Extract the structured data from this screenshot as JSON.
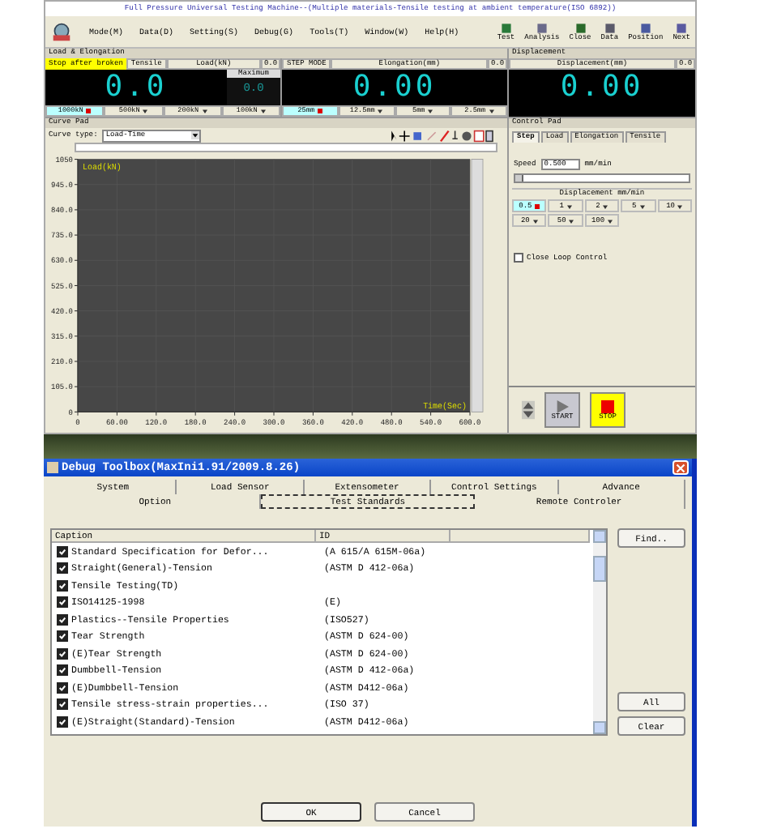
{
  "main_window": {
    "title": "Full Pressure Universal Testing Machine--(Multiple materials-Tensile testing at ambient temperature(ISO 6892))",
    "menus": [
      "Mode(M)",
      "Data(D)",
      "Setting(S)",
      "Debug(G)",
      "Tools(T)",
      "Window(W)",
      "Help(H)"
    ],
    "toolbar": [
      "Test",
      "Analysis",
      "Close",
      "Data",
      "Position",
      "Next"
    ]
  },
  "load_panel": {
    "title": "Load & Elongation",
    "mode_badge": "Stop after broken",
    "mode": "Tensile",
    "load": {
      "label": "Load(kN)",
      "reset": "0.0",
      "value": "0.0",
      "max_label": "Maximum",
      "max_value": "0.0",
      "ranges": [
        {
          "label": "1000kN",
          "selected": true
        },
        {
          "label": "500kN",
          "selected": false
        },
        {
          "label": "200kN",
          "selected": false
        },
        {
          "label": "100kN",
          "selected": false
        }
      ]
    },
    "elongation": {
      "mode": "STEP MODE",
      "label": "Elongation(mm)",
      "reset": "0.0",
      "value": "0.00",
      "ranges": [
        {
          "label": "25mm",
          "selected": true
        },
        {
          "label": "12.5mm",
          "selected": false
        },
        {
          "label": "5mm",
          "selected": false
        },
        {
          "label": "2.5mm",
          "selected": false
        }
      ]
    }
  },
  "displacement_panel": {
    "title": "Displacement",
    "label": "Displacement(mm)",
    "reset": "0.0",
    "value": "0.00"
  },
  "curve_pad": {
    "title": "Curve Pad",
    "curve_type_label": "Curve type:",
    "curve_type": "Load-Time",
    "chart_data": {
      "type": "line",
      "grid": true,
      "xlabel": "Time(Sec)",
      "ylabel": "Load(kN)",
      "xlim": [
        0,
        600
      ],
      "ylim": [
        0,
        1050
      ],
      "xticks": [
        {
          "value": 0,
          "label": "0"
        },
        {
          "value": 60,
          "label": "60.00"
        },
        {
          "value": 120,
          "label": "120.0"
        },
        {
          "value": 180,
          "label": "180.0"
        },
        {
          "value": 240,
          "label": "240.0"
        },
        {
          "value": 300,
          "label": "300.0"
        },
        {
          "value": 360,
          "label": "360.0"
        },
        {
          "value": 420,
          "label": "420.0"
        },
        {
          "value": 480,
          "label": "480.0"
        },
        {
          "value": 540,
          "label": "540.0"
        },
        {
          "value": 600,
          "label": "600.0"
        }
      ],
      "yticks": [
        {
          "value": 0,
          "label": "0"
        },
        {
          "value": 105,
          "label": "105.0"
        },
        {
          "value": 210,
          "label": "210.0"
        },
        {
          "value": 315,
          "label": "315.0"
        },
        {
          "value": 420,
          "label": "420.0"
        },
        {
          "value": 525,
          "label": "525.0"
        },
        {
          "value": 630,
          "label": "630.0"
        },
        {
          "value": 735,
          "label": "735.0"
        },
        {
          "value": 840,
          "label": "840.0"
        },
        {
          "value": 945,
          "label": "945.0"
        },
        {
          "value": 1050,
          "label": "1050"
        }
      ]
    }
  },
  "control_pad": {
    "title": "Control Pad",
    "tabs": [
      {
        "label": "Step",
        "selected": true
      },
      {
        "label": "Load",
        "selected": false
      },
      {
        "label": "Elongation",
        "selected": false
      },
      {
        "label": "Tensile",
        "selected": false
      }
    ],
    "speed_label": "Speed",
    "speed": "0.500",
    "speed_unit": "mm/min",
    "speed_slider": {
      "level": 0
    },
    "group_title": "Displacement mm/min",
    "rates": [
      {
        "label": "0.5",
        "selected": true
      },
      {
        "label": "1",
        "selected": false
      },
      {
        "label": "2",
        "selected": false
      },
      {
        "label": "5",
        "selected": false
      },
      {
        "label": "10",
        "selected": false
      },
      {
        "label": "20",
        "selected": false
      },
      {
        "label": "50",
        "selected": false
      },
      {
        "label": "100",
        "selected": false
      }
    ],
    "close_loop": {
      "label": "Close Loop Control",
      "checked": false
    },
    "start": "START",
    "stop": "STOP"
  },
  "dialog": {
    "title": "Debug Toolbox(MaxIni1.91/2009.8.26)",
    "tabs_row1": [
      {
        "label": "System",
        "selected": false
      },
      {
        "label": "Load Sensor",
        "selected": false
      },
      {
        "label": "Extensometer",
        "selected": false
      },
      {
        "label": "Control Settings",
        "selected": false
      },
      {
        "label": "Advance",
        "selected": false
      }
    ],
    "tabs_row2": [
      {
        "label": "Option",
        "selected": false
      },
      {
        "label": "Test Standards",
        "selected": true
      },
      {
        "label": "Remote Controler",
        "selected": false
      }
    ],
    "columns": [
      "Caption",
      "ID"
    ],
    "rows": [
      {
        "caption": "Standard Specification for Defor...",
        "id": "(A 615/A 615M-06a)",
        "checked": true
      },
      {
        "caption": "Straight(General)-Tension",
        "id": "(ASTM D 412-06a)",
        "checked": true
      },
      {
        "caption": "Tensile Testing(TD)",
        "checked": true
      },
      {
        "caption": "ISO14125-1998",
        "id": "(E)",
        "checked": true
      },
      {
        "caption": "Plastics--Tensile Properties",
        "id": "(ISO527)",
        "checked": true
      },
      {
        "caption": "Tear Strength",
        "id": "(ASTM D 624-00)",
        "checked": true
      },
      {
        "caption": "(E)Tear Strength",
        "id": "(ASTM D 624-00)",
        "checked": true
      },
      {
        "caption": "Dumbbell-Tension",
        "id": "(ASTM D 412-06a)",
        "checked": true
      },
      {
        "caption": "(E)Dumbbell-Tension",
        "id": "(ASTM D412-06a)",
        "checked": true
      },
      {
        "caption": "Tensile stress-strain properties...",
        "id": "(ISO 37)",
        "checked": true
      },
      {
        "caption": "(E)Straight(Standard)-Tension",
        "id": "(ASTM D412-06a)",
        "checked": true
      }
    ],
    "side_buttons": [
      "Find..",
      "All",
      "Clear"
    ],
    "ok": "OK",
    "cancel": "Cancel"
  }
}
